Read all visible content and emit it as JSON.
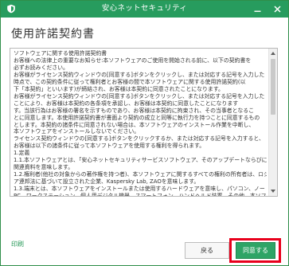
{
  "window": {
    "title": "安心ネットセキュリティ"
  },
  "page_title": "使用許諾契約書",
  "license": {
    "lines": [
      "ソフトウェアに関する使用許諾契約書",
      "お客様への法律上の重要なお知らせ:本ソフトウェアのご使用を開始される前に、以下の契約書を",
      "必ずお読みください。",
      "お客様がライセンス契約ウィンドウの[同意する]ボタンをクリックし、または対応する記号を入力した",
      "時点で、この契約条件に従って権利者とお客様の間で本ソフトウェアに関する使用許諾契約(以",
      "下「本契約」といいます)が締結され、お客様は本契約に同意されたことになります。",
      "お客様がライセンス契約ウィンドウの[同意する]ボタンをクリックし、または対応する記号を入力した",
      "ことにより、お客様は本契約の各条項を承認し、お客様は本契約に同意したことになります",
      "す。当該行為はお客様の署名を示すものであり、お客様は本契約に拘束され、その当事者となるこ",
      "とに同意します。本使用許諾契約書が書面より契約の成立と同等に執行力を持つことに同意するもの",
      "とします。本契約の諸条件に同意されない場合は、本ソフトウェアのインストール作業を中断し、",
      "本ソフトウェアをインストールしないでください。",
      "ライセンス契約ウィンドウの[同意する]ボタンをクリックするか、または対応する記号を入力すると、",
      "お客様は以下の諸条件に従って本ソフトウェアを使用する権利を得られます。",
      "1.定義",
      "1.1.本ソフトウェアとは、「安心ネットセキュリティサービスソフトウェア、そのアップデートならびに",
      "関連資料を意味します。",
      "1.2.権利者(他社の対象からの著作権を持つ者)、本ソフトウェアに関するすべての権利の所有者は、ロシ",
      "ア連邦法に基づいて設立された企業、Kaspersky Lab, ZAOを意味します。",
      "1.3.端末とは、本ソフトウェアをインストールまたは使用するハードウェアを意味し、パソコン、ノート",
      "PC、ワークステーション、個人用デジタル機器、スマートフォン、ハンドヘルド装置、その他、本ソフト",
      "ウェアが対応する電子装置を含みます。",
      "1.4.お客様とは、自身のために本ソフトウェアをインストールまたは使用する個人、または本ソフトウェ"
    ]
  },
  "footer": {
    "print_label": "印刷",
    "back_label": "戻る",
    "agree_label": "同意する"
  },
  "colors": {
    "titlebar": "#279c5e",
    "accent": "#2ea466",
    "highlight": "#e8001c"
  }
}
